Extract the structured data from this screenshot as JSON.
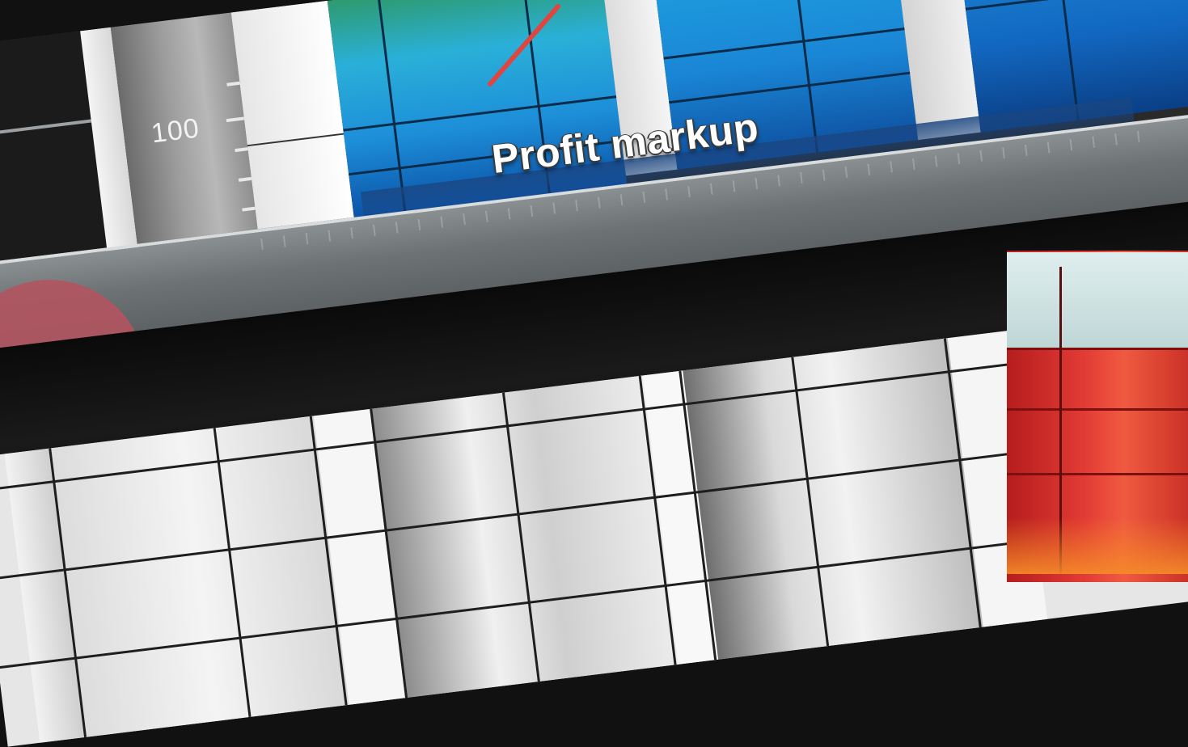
{
  "chart": {
    "title": "Profit markup",
    "y_tick_label": "100"
  },
  "colors": {
    "plot_blue": "#1d8fd9",
    "plot_green": "#2e9a6e",
    "trend_line": "#e0453f",
    "bar_red": "#e23b35",
    "title_text": "#ffffff"
  }
}
